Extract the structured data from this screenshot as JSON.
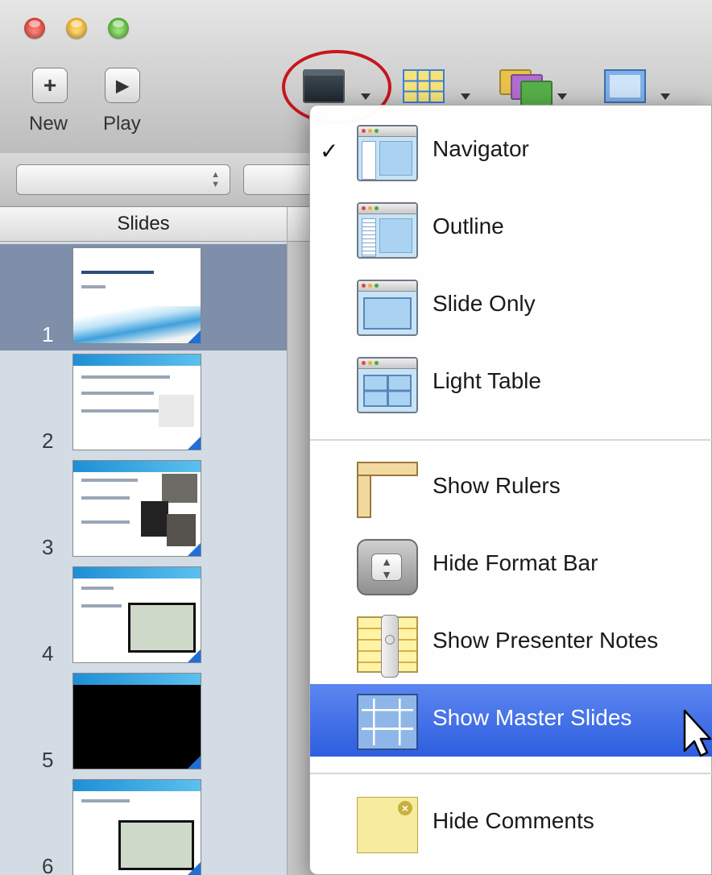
{
  "toolbar": {
    "new_label": "New",
    "play_label": "Play",
    "new_glyph": "+",
    "play_glyph": "▶"
  },
  "format_bar": {
    "popup_arrows": "▲\n▼"
  },
  "slides_panel": {
    "header": "Slides",
    "slides": [
      {
        "number": "1",
        "selected": true
      },
      {
        "number": "2",
        "selected": false
      },
      {
        "number": "3",
        "selected": false
      },
      {
        "number": "4",
        "selected": false
      },
      {
        "number": "5",
        "selected": false
      },
      {
        "number": "6",
        "selected": false
      }
    ]
  },
  "view_menu": {
    "items": [
      {
        "label": "Navigator",
        "checked": true,
        "check_glyph": "✓",
        "icon": "navigator-icon"
      },
      {
        "label": "Outline",
        "icon": "outline-icon"
      },
      {
        "label": "Slide Only",
        "icon": "slide-only-icon"
      },
      {
        "label": "Light Table",
        "icon": "light-table-icon"
      },
      {
        "label": "Show Rulers",
        "icon": "ruler-icon"
      },
      {
        "label": "Hide Format Bar",
        "icon": "format-bar-icon"
      },
      {
        "label": "Show Presenter Notes",
        "icon": "presenter-notes-icon"
      },
      {
        "label": "Show Master Slides",
        "icon": "master-slides-icon",
        "highlighted": true
      },
      {
        "label": "Hide Comments",
        "icon": "comment-icon"
      }
    ]
  },
  "colors": {
    "menu_highlight": "#2e5ee0",
    "selected_slide_row": "#7f8ea9",
    "callout_circle": "#c6161c"
  }
}
